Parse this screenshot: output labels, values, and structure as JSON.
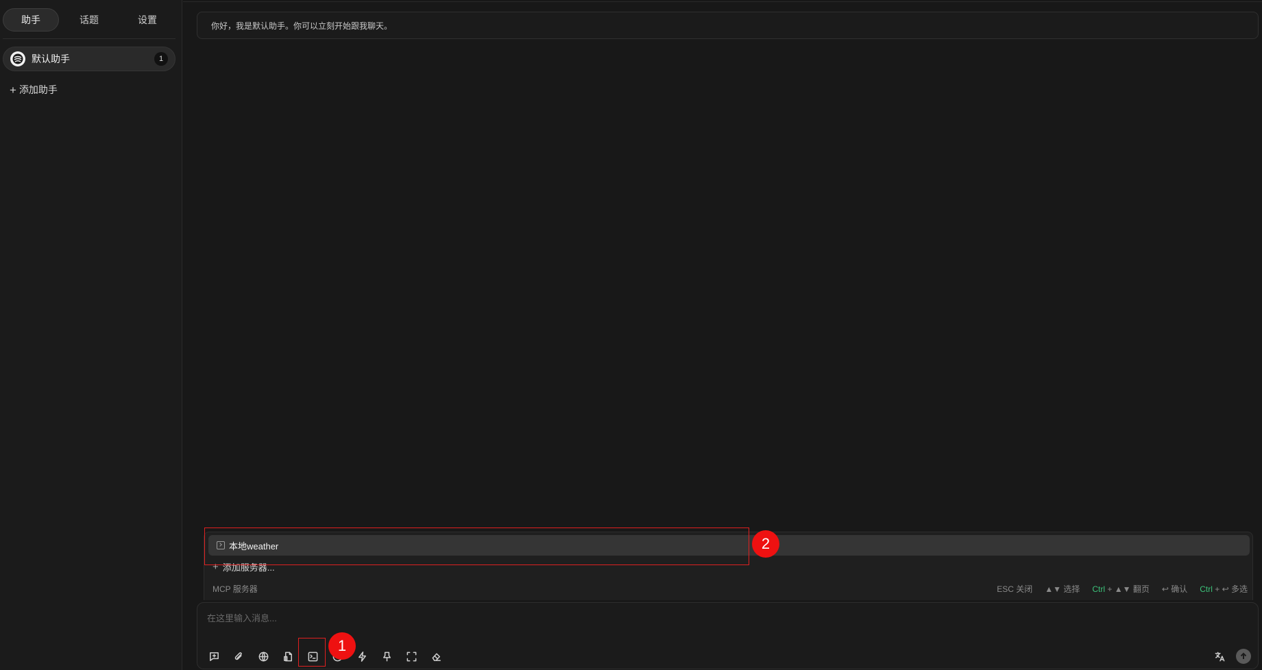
{
  "sidebar": {
    "tabs": [
      {
        "label": "助手",
        "active": true
      },
      {
        "label": "话题",
        "active": false
      },
      {
        "label": "设置",
        "active": false
      }
    ],
    "assistant": {
      "label": "默认助手",
      "count": "1"
    },
    "add_assistant_label": "添加助手"
  },
  "main": {
    "welcome_message": "你好，我是默认助手。你可以立刻开始跟我聊天。"
  },
  "mcp_popup": {
    "server_label": "本地weather",
    "add_server_label": "添加服务器...",
    "footer_title": "MCP 服务器",
    "hints": {
      "esc": "ESC 关闭",
      "select": "▲▼ 选择",
      "page_key": "Ctrl",
      "page_rest": "▲▼ 翻页",
      "confirm": "↩ 确认",
      "multi_key": "Ctrl",
      "multi_rest": "↩ 多选",
      "plus": "+"
    }
  },
  "input": {
    "placeholder": "在这里输入消息..."
  },
  "toolbar_icons": [
    "new-topic-icon",
    "attachment-icon",
    "globe-icon",
    "knowledge-file-icon",
    "mcp-terminal-icon",
    "mention-model-icon",
    "quick-phrase-icon",
    "pin-icon",
    "expand-icon",
    "clear-icon"
  ],
  "annotations": {
    "badge_1": "1",
    "badge_2": "2",
    "color": "#ee1111"
  },
  "colors": {
    "background": "#181818",
    "accent_green": "#3cc27a"
  }
}
